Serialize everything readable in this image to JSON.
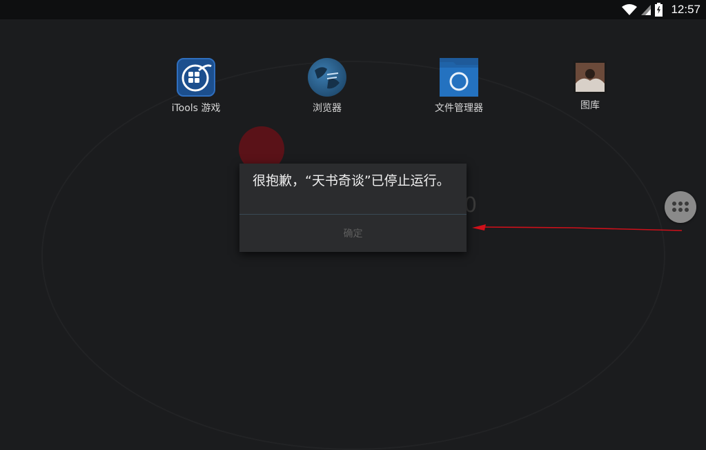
{
  "status_bar": {
    "time": "12:57",
    "icons": [
      "wifi-icon",
      "signal-icon",
      "battery-charging-icon"
    ]
  },
  "home_screen": {
    "apps": [
      {
        "label": "iTools 游戏",
        "icon": "itools-games-icon"
      },
      {
        "label": "浏览器",
        "icon": "browser-icon"
      },
      {
        "label": "文件管理器",
        "icon": "file-manager-icon"
      },
      {
        "label": "图库",
        "icon": "gallery-icon"
      }
    ],
    "launcher_icon": "app-drawer-icon"
  },
  "dialog": {
    "message": "很抱歉，“天书奇谈”已停止运行。",
    "ok_button": "确定"
  },
  "annotation": {
    "color": "#d0101a"
  }
}
